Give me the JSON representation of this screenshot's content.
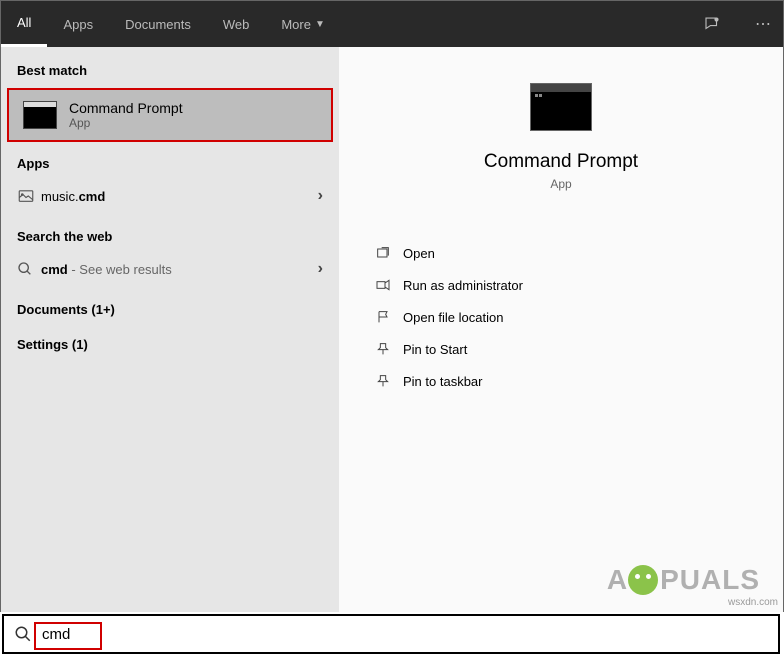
{
  "tabs": {
    "all": "All",
    "apps": "Apps",
    "documents": "Documents",
    "web": "Web",
    "more": "More"
  },
  "sections": {
    "best_match": "Best match",
    "apps": "Apps",
    "search_web": "Search the web",
    "documents": "Documents (1+)",
    "settings": "Settings (1)"
  },
  "best": {
    "title": "Command Prompt",
    "subtitle": "App"
  },
  "apps_list": {
    "item1_prefix": "music.",
    "item1_bold": "cmd"
  },
  "web": {
    "query": "cmd",
    "suffix": " - See web results"
  },
  "preview": {
    "title": "Command Prompt",
    "subtitle": "App"
  },
  "actions": {
    "open": "Open",
    "run_admin": "Run as administrator",
    "open_loc": "Open file location",
    "pin_start": "Pin to Start",
    "pin_taskbar": "Pin to taskbar"
  },
  "search": {
    "value": "cmd"
  },
  "watermark": {
    "pre": "A",
    "post": "PUALS"
  },
  "attribution": "wsxdn.com"
}
